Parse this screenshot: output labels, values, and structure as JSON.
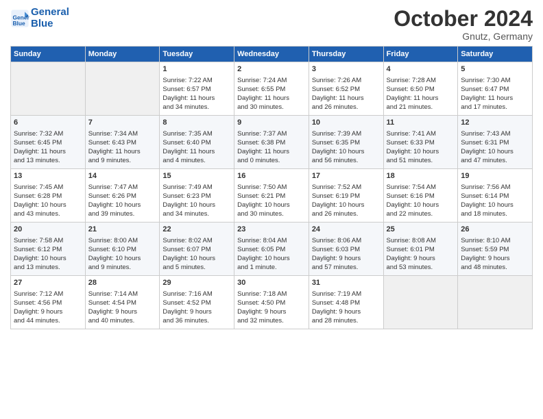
{
  "header": {
    "logo_line1": "General",
    "logo_line2": "Blue",
    "month": "October 2024",
    "location": "Gnutz, Germany"
  },
  "weekdays": [
    "Sunday",
    "Monday",
    "Tuesday",
    "Wednesday",
    "Thursday",
    "Friday",
    "Saturday"
  ],
  "weeks": [
    [
      {
        "day": "",
        "info": ""
      },
      {
        "day": "",
        "info": ""
      },
      {
        "day": "1",
        "info": "Sunrise: 7:22 AM\nSunset: 6:57 PM\nDaylight: 11 hours\nand 34 minutes."
      },
      {
        "day": "2",
        "info": "Sunrise: 7:24 AM\nSunset: 6:55 PM\nDaylight: 11 hours\nand 30 minutes."
      },
      {
        "day": "3",
        "info": "Sunrise: 7:26 AM\nSunset: 6:52 PM\nDaylight: 11 hours\nand 26 minutes."
      },
      {
        "day": "4",
        "info": "Sunrise: 7:28 AM\nSunset: 6:50 PM\nDaylight: 11 hours\nand 21 minutes."
      },
      {
        "day": "5",
        "info": "Sunrise: 7:30 AM\nSunset: 6:47 PM\nDaylight: 11 hours\nand 17 minutes."
      }
    ],
    [
      {
        "day": "6",
        "info": "Sunrise: 7:32 AM\nSunset: 6:45 PM\nDaylight: 11 hours\nand 13 minutes."
      },
      {
        "day": "7",
        "info": "Sunrise: 7:34 AM\nSunset: 6:43 PM\nDaylight: 11 hours\nand 9 minutes."
      },
      {
        "day": "8",
        "info": "Sunrise: 7:35 AM\nSunset: 6:40 PM\nDaylight: 11 hours\nand 4 minutes."
      },
      {
        "day": "9",
        "info": "Sunrise: 7:37 AM\nSunset: 6:38 PM\nDaylight: 11 hours\nand 0 minutes."
      },
      {
        "day": "10",
        "info": "Sunrise: 7:39 AM\nSunset: 6:35 PM\nDaylight: 10 hours\nand 56 minutes."
      },
      {
        "day": "11",
        "info": "Sunrise: 7:41 AM\nSunset: 6:33 PM\nDaylight: 10 hours\nand 51 minutes."
      },
      {
        "day": "12",
        "info": "Sunrise: 7:43 AM\nSunset: 6:31 PM\nDaylight: 10 hours\nand 47 minutes."
      }
    ],
    [
      {
        "day": "13",
        "info": "Sunrise: 7:45 AM\nSunset: 6:28 PM\nDaylight: 10 hours\nand 43 minutes."
      },
      {
        "day": "14",
        "info": "Sunrise: 7:47 AM\nSunset: 6:26 PM\nDaylight: 10 hours\nand 39 minutes."
      },
      {
        "day": "15",
        "info": "Sunrise: 7:49 AM\nSunset: 6:23 PM\nDaylight: 10 hours\nand 34 minutes."
      },
      {
        "day": "16",
        "info": "Sunrise: 7:50 AM\nSunset: 6:21 PM\nDaylight: 10 hours\nand 30 minutes."
      },
      {
        "day": "17",
        "info": "Sunrise: 7:52 AM\nSunset: 6:19 PM\nDaylight: 10 hours\nand 26 minutes."
      },
      {
        "day": "18",
        "info": "Sunrise: 7:54 AM\nSunset: 6:16 PM\nDaylight: 10 hours\nand 22 minutes."
      },
      {
        "day": "19",
        "info": "Sunrise: 7:56 AM\nSunset: 6:14 PM\nDaylight: 10 hours\nand 18 minutes."
      }
    ],
    [
      {
        "day": "20",
        "info": "Sunrise: 7:58 AM\nSunset: 6:12 PM\nDaylight: 10 hours\nand 13 minutes."
      },
      {
        "day": "21",
        "info": "Sunrise: 8:00 AM\nSunset: 6:10 PM\nDaylight: 10 hours\nand 9 minutes."
      },
      {
        "day": "22",
        "info": "Sunrise: 8:02 AM\nSunset: 6:07 PM\nDaylight: 10 hours\nand 5 minutes."
      },
      {
        "day": "23",
        "info": "Sunrise: 8:04 AM\nSunset: 6:05 PM\nDaylight: 10 hours\nand 1 minute."
      },
      {
        "day": "24",
        "info": "Sunrise: 8:06 AM\nSunset: 6:03 PM\nDaylight: 9 hours\nand 57 minutes."
      },
      {
        "day": "25",
        "info": "Sunrise: 8:08 AM\nSunset: 6:01 PM\nDaylight: 9 hours\nand 53 minutes."
      },
      {
        "day": "26",
        "info": "Sunrise: 8:10 AM\nSunset: 5:59 PM\nDaylight: 9 hours\nand 48 minutes."
      }
    ],
    [
      {
        "day": "27",
        "info": "Sunrise: 7:12 AM\nSunset: 4:56 PM\nDaylight: 9 hours\nand 44 minutes."
      },
      {
        "day": "28",
        "info": "Sunrise: 7:14 AM\nSunset: 4:54 PM\nDaylight: 9 hours\nand 40 minutes."
      },
      {
        "day": "29",
        "info": "Sunrise: 7:16 AM\nSunset: 4:52 PM\nDaylight: 9 hours\nand 36 minutes."
      },
      {
        "day": "30",
        "info": "Sunrise: 7:18 AM\nSunset: 4:50 PM\nDaylight: 9 hours\nand 32 minutes."
      },
      {
        "day": "31",
        "info": "Sunrise: 7:19 AM\nSunset: 4:48 PM\nDaylight: 9 hours\nand 28 minutes."
      },
      {
        "day": "",
        "info": ""
      },
      {
        "day": "",
        "info": ""
      }
    ]
  ]
}
